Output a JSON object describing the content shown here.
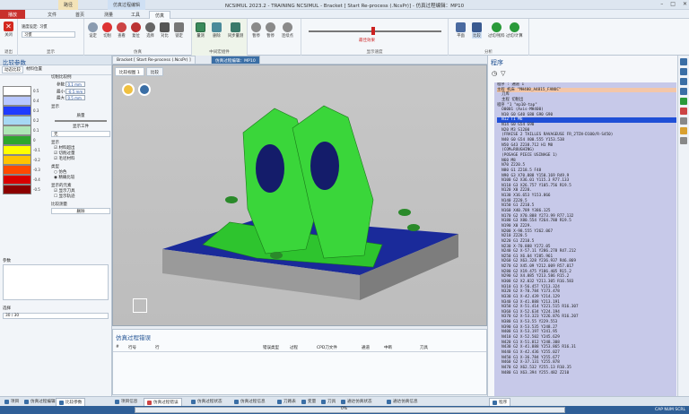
{
  "window": {
    "title": "NCSIMUL 2023.2 - TRAINING NCSIMUL - Bracket [ Start Re-process (.NcsPr)] - 仿真过程编辑：MP10",
    "context_tab1": "路径",
    "context_tab2": "仿真过程编辑"
  },
  "menu": [
    "文件",
    "首页",
    "测量",
    "工具",
    "仿真"
  ],
  "menu_file": "播放",
  "ribbon": {
    "groups": [
      {
        "label": "退出"
      },
      {
        "label": "显示"
      },
      {
        "label": "仿真"
      },
      {
        "label": "中间宏组件"
      },
      {
        "label": "显示速度"
      },
      {
        "label": "分析"
      }
    ],
    "buttons": {
      "close": "关闭",
      "mode_label": "速度设定: 习惯",
      "mode_value": "习惯",
      "settings": "设定",
      "cut": "切削",
      "view": "查看",
      "rewind": "复位",
      "select": "选择",
      "compare": "对比",
      "lock": "锁定",
      "align": "量测",
      "delete": "删除",
      "sync": "同步量测",
      "pause": "暂停",
      "stop": "暂停",
      "step": "连续点",
      "multi": "运行",
      "speed_label": "最佳效果",
      "flat": "平面",
      "compare_btn": "比较",
      "lcheck": "过切/残料",
      "fcheck": "过切/计算"
    }
  },
  "left": {
    "title": "比较参数",
    "tabs": [
      "动态比较",
      "材料位置"
    ],
    "legend": [
      "0.5",
      "0.4",
      "0.3",
      "0.2",
      "0.1",
      "0",
      "-0.1",
      "-0.2",
      "-0.3",
      "-0.4",
      "-0.5"
    ],
    "legend_colors": [
      "#ffffff",
      "#b8c7ff",
      "#1f3bff",
      "#a6d8f4",
      "#aee6b6",
      "#2ea62e",
      "#ffff00",
      "#ffc400",
      "#ff4a00",
      "#d90000",
      "#8c0000"
    ],
    "opts_title": "切削比较例",
    "param1_label": "参数",
    "param1": "0.1 mm",
    "param2_label": "最小",
    "param2": "-0.5 mm",
    "param3_label": "最大",
    "param3": "0.5 mm",
    "display_label": "显示",
    "quality_label": "质量",
    "show_work": "显示工件",
    "show_sel": "无",
    "display2": "显示",
    "check_items": [
      "材料超出",
      "切削过量",
      "毛坯材料"
    ],
    "type_label": "类型",
    "type_opts": [
      "仿色",
      "精确比较"
    ],
    "display3": "显示的元素",
    "display3_items": [
      "显示刀具",
      "显示轨迹"
    ],
    "result_label": "比较测量",
    "result_btn": "删除",
    "params_title": "参数",
    "select_label": "选择",
    "select_value": "30 / 30"
  },
  "doc_tabs": [
    "比较视图 1",
    "比较"
  ],
  "doc_tab2": "Bracket [ Start Re-process (.NcsPr) ]",
  "doc_tab3": "仿真过程编辑：MP10",
  "errors": {
    "title": "仿真过程错误",
    "columns": [
      "#",
      "行号",
      "行",
      "错误类型",
      "过程",
      "CPD刀文件",
      "通道",
      "中断",
      "刀具"
    ]
  },
  "program": {
    "title": "程序",
    "lines": [
      "程序 : 通道 1",
      "主程 机床 \"MH400_A4815_FANUC\"",
      "  刀库",
      "  主程 切削出",
      "程序 \"1 \"mp10-tap\"",
      "  O0001 (Axis-MH400)",
      "  N10 G0 G40 G80 G90 G90",
      "  N12 T1 M6",
      "  N14 G0 G54 G90",
      "  N20 M3 S1200",
      "  (FRAISE 2 TAILLES RAVAGEUSE FR_2TIN-D100/R-S450)",
      "  N40 G0 G54 X00.555 Y153.538",
      "  N50 G43 Z238.712 H1 M8",
      "  (COM=ROUGHING)",
      "  (POSAGE PIECE USINAGE 1)",
      "  N60 M8",
      "  N70 Z220.5",
      "  N80 G1 Z218.5 F48",
      "  N90 G3 X70.888 Y150.169 R49.9",
      "  N100 G2 X36.01 Y115.3 R77.133",
      "  N110 G3 X26.757 Y105.756 R19.5",
      "  N120 X0 Z220.",
      "  N130 X16.653 Y153.866",
      "  N140 Z220.5",
      "  N150 G1 Z210.5",
      "  N160 X40.789 Y386.125",
      "  N170 G2 X70.888 Y273.99 R77.132",
      "  N180 G3 X80.554 Y264.788 R19.5",
      "  N190 X0 Z229.",
      "  N200 X-98.555 Y262.067",
      "  N210 Z220.5",
      "  N220 G1 Z210.5",
      "  N230 X-70.888 Y272.05",
      "  N240 G2 X-57.11 Y286.278 R47.212",
      "  N250 G1 X6.04 Y285.961",
      "  N260 G2 X63.328 Y236.937 R46.869",
      "  N270 G2 X45.09 Y212.009 R57.017",
      "  N280 G2 X19.475 Y186.405 R15.2",
      "  N290 G2 X4.885 Y213.586 R15.2",
      "  N300 G2 X2.032 Y211.305 R16.583",
      "  N310 G1 X-56.457 Y213.324",
      "  N320 G2 X-70.784 Y173.478",
      "  N330 G1 X-42.439 Y214.129",
      "  N340 G3 X-41.888 Y213.191",
      "  N350 G2 X-51.414 Y221.515 R16.307",
      "  N360 G1 X-52.634 Y224.194",
      "  N370 G2 X-53.323 Y226.876 R16.207",
      "  N380 G1 X-53.55 Y229.553",
      "  N390 G3 X-53.535 Y248.27",
      "  N400 G1 X-53.197 Y241.95",
      "  N410 G2 X-52.502 Y245.629",
      "  N420 G1 X-51.812 Y248.308",
      "  N430 G2 X-41.888 Y253.865 R16.31",
      "  N440 G1 X-42.436 Y255.027",
      "  N450 G1 X-36.784 Y255.677",
      "  N460 G2 X-37.131 Y255.878",
      "  N470 G2 X62.532 Y255.13 R10.35",
      "  N480 G1 X63.394 Y255.482 Z210"
    ]
  },
  "bottom_tabs_left": [
    "项目",
    "仿真过程编辑",
    "比较参数"
  ],
  "bottom_tabs_mid": [
    "项目信息",
    "仿真过程错误",
    "仿真过程状态",
    "仿真过程信息",
    "刀路表",
    "变量",
    "刀具",
    "通达仿真状态",
    "通达仿真信息"
  ],
  "bottom_tabs_right": [
    "程序"
  ],
  "status": {
    "progress": "0%",
    "right": "CAP NUM SCRL"
  }
}
